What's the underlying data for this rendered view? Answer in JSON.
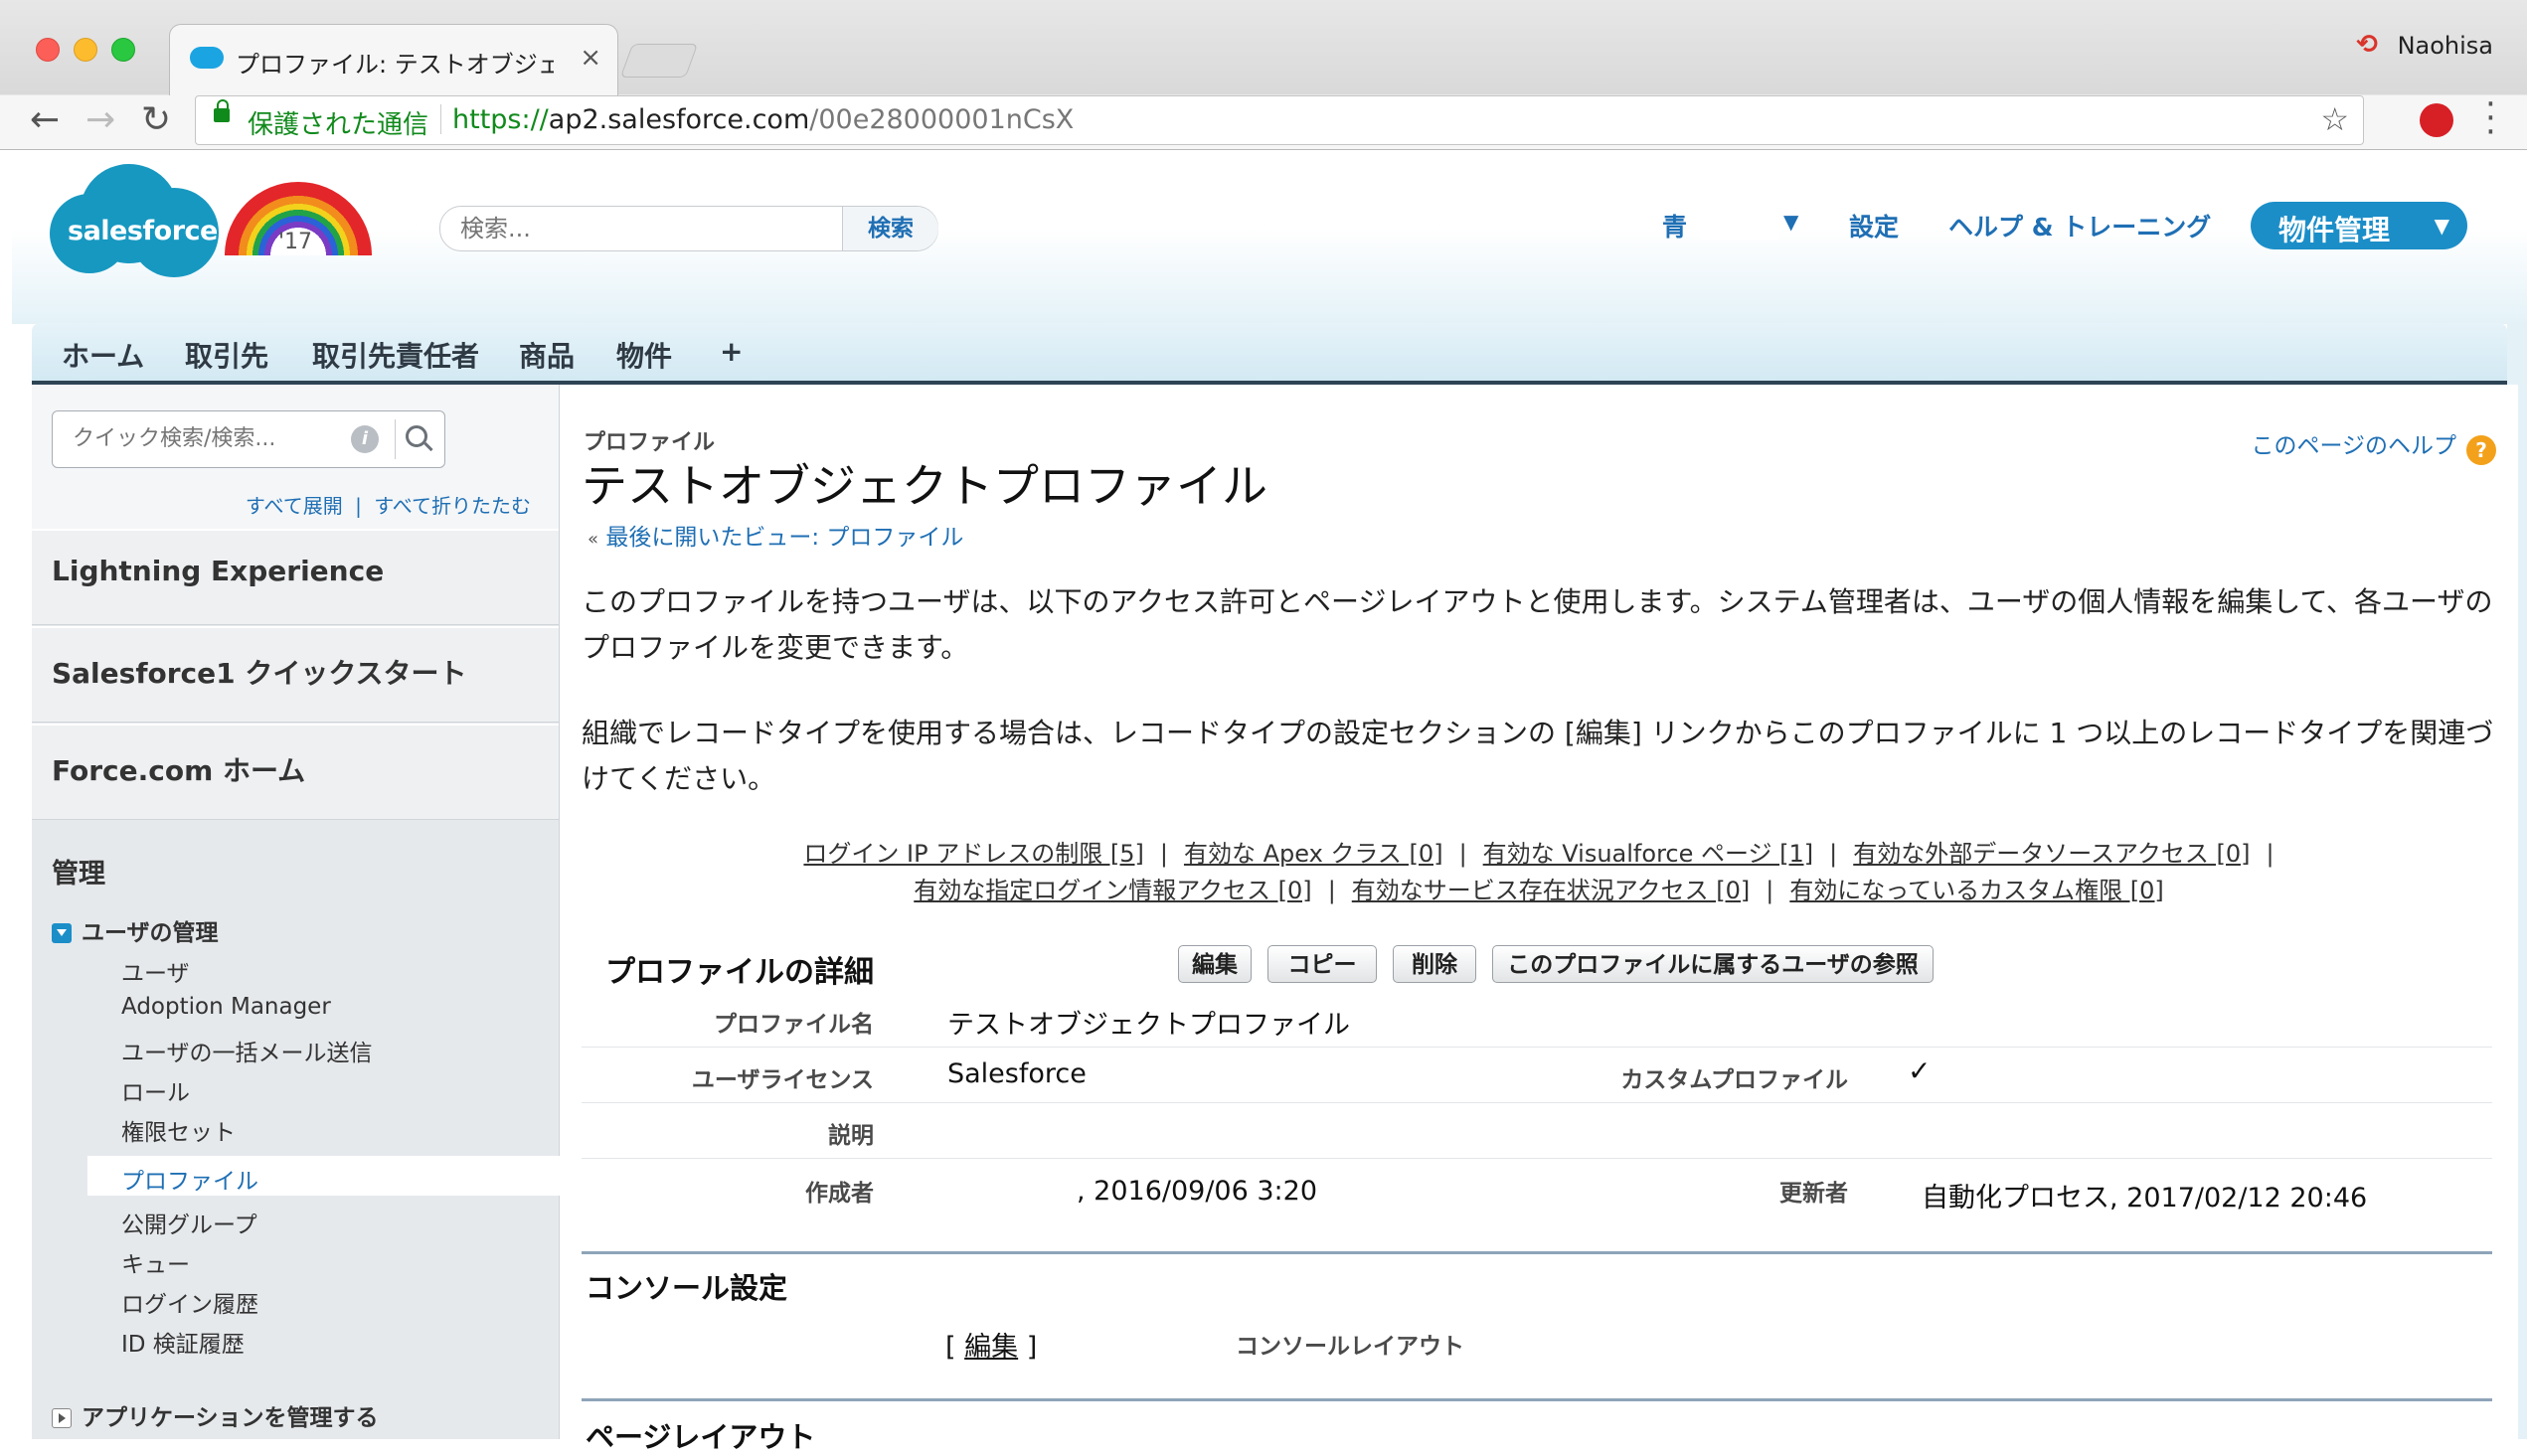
{
  "browser": {
    "tab_title": "プロファイル: テストオブジェクト",
    "tab_close": "×",
    "profile_name": "Naohisa",
    "back": "←",
    "forward": "→",
    "reload": "↻",
    "secure_label": "保護された通信",
    "url_scheme": "https://",
    "url_host": "ap2.salesforce.com",
    "url_path": "/00e28000001nCsX",
    "bookmark_star": "☆"
  },
  "header": {
    "logo_text": "salesforce",
    "rainbow_year": "'17",
    "search_placeholder": "検索...",
    "search_button": "検索",
    "user_name": "青",
    "settings": "設定",
    "help_training": "ヘルプ & トレーニング",
    "app_name": "物件管理"
  },
  "tabs": [
    "ホーム",
    "取引先",
    "取引先責任者",
    "商品",
    "物件",
    "+"
  ],
  "sidebar": {
    "quick_search_placeholder": "クイック検索/検索...",
    "expand_all": "すべて展開",
    "collapse_all": "すべて折りたたむ",
    "link_sep": "|",
    "sections": [
      "Lightning Experience",
      "Salesforce1 クイックスタート",
      "Force.com ホーム"
    ],
    "manage": "管理",
    "user_management": "ユーザの管理",
    "user_items": [
      "ユーザ",
      "Adoption Manager",
      "ユーザの一括メール送信",
      "ロール",
      "権限セット",
      "プロファイル",
      "公開グループ",
      "キュー",
      "ログイン履歴",
      "ID 検証履歴"
    ],
    "active_item": "プロファイル",
    "manage_apps": "アプリケーションを管理する"
  },
  "main": {
    "breadcrumb": "プロファイル",
    "title": "テストオブジェクトプロファイル",
    "back_prefix": "«",
    "back_link": "最後に開いたビュー: プロファイル",
    "help_link": "このページのヘルプ",
    "help_icon": "?",
    "para1": "このプロファイルを持つユーザは、以下のアクセス許可とページレイアウトと使用します。システム管理者は、ユーザの個人情報を編集して、各ユーザのプロファイルを変更できます。",
    "para2": "組織でレコードタイプを使用する場合は、レコードタイプの設定セクションの [編集] リンクからこのプロファイルに 1 つ以上のレコードタイプを関連づけてください。",
    "related_links_row1": [
      "ログイン IP アドレスの制限 [5]",
      "有効な Apex クラス [0]",
      "有効な Visualforce ページ [1]",
      "有効な外部データソースアクセス [0]"
    ],
    "related_links_row2": [
      "有効な指定ログイン情報アクセス [0]",
      "有効なサービス存在状況アクセス [0]",
      "有効になっているカスタム権限 [0]"
    ],
    "link_sep": "|",
    "detail_title": "プロファイルの詳細",
    "buttons": [
      "編集",
      "コピー",
      "削除",
      "このプロファイルに属するユーザの参照"
    ],
    "fields": {
      "profile_name_label": "プロファイル名",
      "profile_name_value": "テストオブジェクトプロファイル",
      "license_label": "ユーザライセンス",
      "license_value": "Salesforce",
      "custom_label": "カスタムプロファイル",
      "custom_value": "✓",
      "desc_label": "説明",
      "desc_value": "",
      "created_label": "作成者",
      "created_value": ", 2016/09/06 3:20",
      "modified_label": "更新者",
      "modified_value": "自動化プロセス, 2017/02/12 20:46"
    },
    "console_title": "コンソール設定",
    "console_layout_label": "コンソールレイアウト",
    "console_layout_open": "[",
    "console_layout_link": "編集",
    "console_layout_close": "]",
    "page_layout_title": "ページレイアウト"
  }
}
